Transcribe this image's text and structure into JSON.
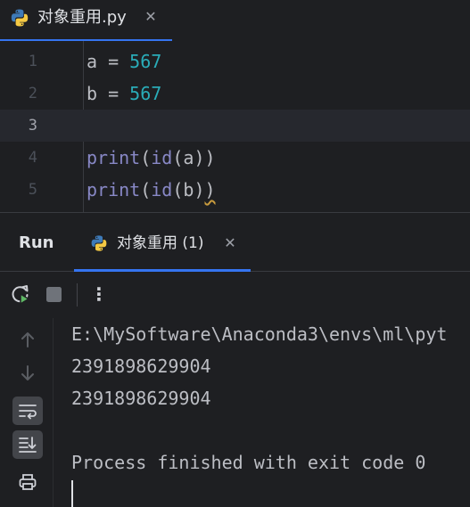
{
  "editor_tab": {
    "icon": "python-file-icon",
    "label": "对象重用.py",
    "close": "✕"
  },
  "editor": {
    "current_line": 3,
    "lines": [
      {
        "number": "1",
        "tokens": [
          {
            "text": "a = ",
            "kind": "plain"
          },
          {
            "text": "567",
            "kind": "number"
          }
        ]
      },
      {
        "number": "2",
        "tokens": [
          {
            "text": "b = ",
            "kind": "plain"
          },
          {
            "text": "567",
            "kind": "number"
          }
        ]
      },
      {
        "number": "3",
        "tokens": []
      },
      {
        "number": "4",
        "tokens": [
          {
            "text": "print",
            "kind": "builtin"
          },
          {
            "text": "(",
            "kind": "plain"
          },
          {
            "text": "id",
            "kind": "builtin"
          },
          {
            "text": "(a))",
            "kind": "plain"
          }
        ]
      },
      {
        "number": "5",
        "tokens": [
          {
            "text": "print",
            "kind": "builtin"
          },
          {
            "text": "(",
            "kind": "plain"
          },
          {
            "text": "id",
            "kind": "builtin"
          },
          {
            "text": "(b)",
            "kind": "plain"
          },
          {
            "text": ")",
            "kind": "warn"
          }
        ]
      }
    ]
  },
  "run_panel": {
    "title": "Run",
    "tab": {
      "icon": "python-run-config-icon",
      "label": "对象重用 (1)",
      "close": "✕"
    },
    "toolbar": {
      "rerun_icon": "rerun-icon",
      "stop_icon": "stop-icon",
      "more_label": "⋮"
    },
    "side_buttons": [
      {
        "icon": "scroll-up-icon",
        "active": false
      },
      {
        "icon": "scroll-down-icon",
        "active": false
      },
      {
        "icon": "soft-wrap-icon",
        "active": true
      },
      {
        "icon": "scroll-to-end-icon",
        "active": true
      },
      {
        "icon": "print-icon",
        "active": false
      }
    ],
    "console_lines": [
      "E:\\MySoftware\\Anaconda3\\envs\\ml\\pyt",
      "2391898629904",
      "2391898629904",
      "",
      "Process finished with exit code 0"
    ]
  },
  "colors": {
    "background": "#1e1f22",
    "accent": "#3574f0",
    "number": "#2aacb8",
    "builtin": "#8888c6",
    "text": "#bcbec4"
  }
}
